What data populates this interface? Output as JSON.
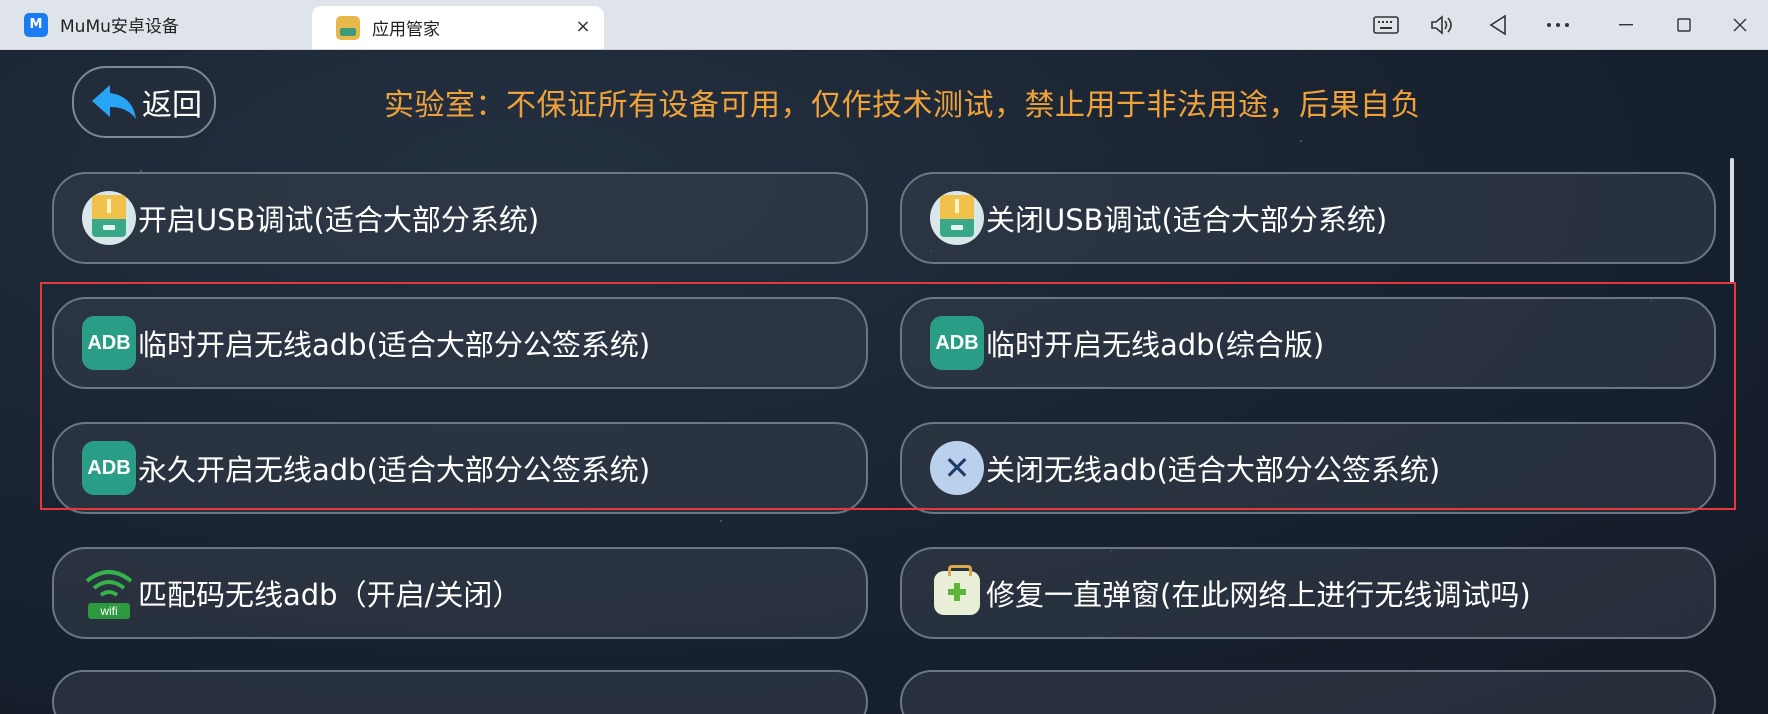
{
  "tabs": [
    {
      "label": "MuMu安卓设备",
      "icon": "mumu-logo-icon"
    },
    {
      "label": "应用管家",
      "icon": "app-manager-icon",
      "close": "×"
    }
  ],
  "window_controls": [
    "keyboard-icon",
    "volume-icon",
    "back-icon",
    "more-icon",
    "minimize-icon",
    "maximize-icon",
    "close-icon"
  ],
  "header": {
    "back_label": "返回",
    "notice": "实验室：不保证所有设备可用，仅作技术测试，禁止用于非法用途，后果自负"
  },
  "options": [
    {
      "label": "开启USB调试(适合大部分系统)",
      "icon": "usb-drive-icon"
    },
    {
      "label": "关闭USB调试(适合大部分系统)",
      "icon": "usb-drive-icon"
    },
    {
      "label": "临时开启无线adb(适合大部分公签系统)",
      "icon": "adb-icon",
      "icon_text": "ADB"
    },
    {
      "label": "临时开启无线adb(综合版)",
      "icon": "adb-icon",
      "icon_text": "ADB"
    },
    {
      "label": "永久开启无线adb(适合大部分公签系统)",
      "icon": "adb-icon",
      "icon_text": "ADB"
    },
    {
      "label": "关闭无线adb(适合大部分公签系统)",
      "icon": "close-x-icon"
    },
    {
      "label": "匹配码无线adb（开启/关闭）",
      "icon": "wifi-icon",
      "icon_text": "wifi"
    },
    {
      "label": "修复一直弹窗(在此网络上进行无线调试吗)",
      "icon": "first-aid-kit-icon"
    }
  ],
  "colors": {
    "notice": "#f0a23a",
    "highlight": "#e5383b",
    "adb": "#2a9d86"
  }
}
